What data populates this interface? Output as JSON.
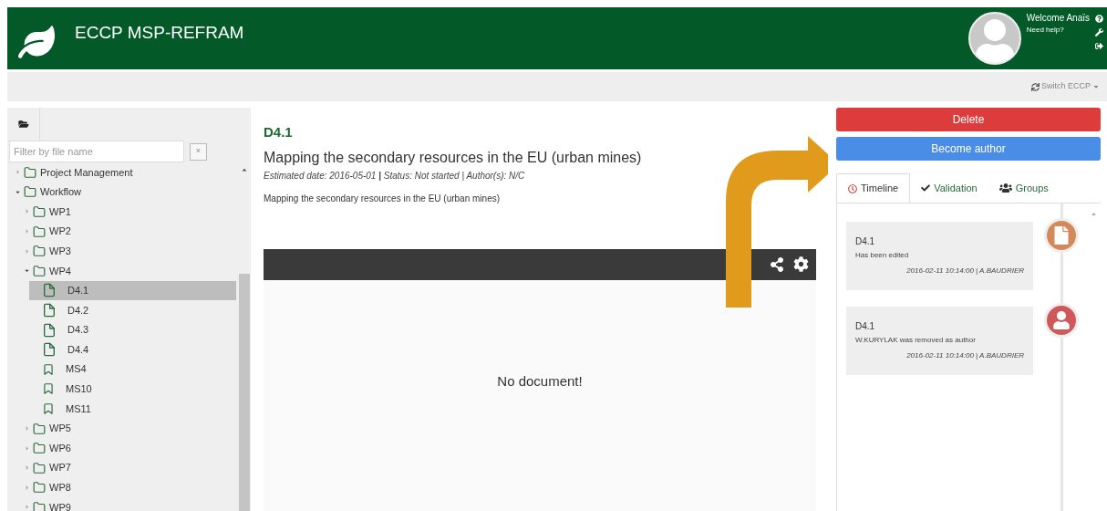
{
  "header": {
    "title": "ECCP MSP-REFRAM",
    "welcome": "Welcome Anaïs",
    "help_link": "Need help?"
  },
  "toolbar": {
    "switch": "Switch ECCP"
  },
  "sidebar": {
    "filter": {
      "placeholder": "Filter by file name",
      "clear": "×"
    },
    "tree": [
      {
        "label": "Project Management",
        "kind": "folder",
        "expanded": false,
        "selected": false
      },
      {
        "label": "Workflow",
        "kind": "folder",
        "expanded": true,
        "selected": false,
        "children": [
          {
            "label": "WP1",
            "kind": "folder",
            "expanded": false,
            "selected": false
          },
          {
            "label": "WP2",
            "kind": "folder",
            "expanded": false,
            "selected": false
          },
          {
            "label": "WP3",
            "kind": "folder",
            "expanded": false,
            "selected": false
          },
          {
            "label": "WP4",
            "kind": "folder",
            "expanded": true,
            "selected": false,
            "children": [
              {
                "label": "D4.1",
                "kind": "document",
                "selected": true
              },
              {
                "label": "D4.2",
                "kind": "document",
                "selected": false
              },
              {
                "label": "D4.3",
                "kind": "document",
                "selected": false
              },
              {
                "label": "D4.4",
                "kind": "document",
                "selected": false
              },
              {
                "label": "MS4",
                "kind": "milestone",
                "selected": false
              },
              {
                "label": "MS10",
                "kind": "milestone",
                "selected": false
              },
              {
                "label": "MS11",
                "kind": "milestone",
                "selected": false
              }
            ]
          },
          {
            "label": "WP5",
            "kind": "folder",
            "expanded": false,
            "selected": false
          },
          {
            "label": "WP6",
            "kind": "folder",
            "expanded": false,
            "selected": false
          },
          {
            "label": "WP7",
            "kind": "folder",
            "expanded": false,
            "selected": false
          },
          {
            "label": "WP8",
            "kind": "folder",
            "expanded": false,
            "selected": false
          },
          {
            "label": "WP9",
            "kind": "folder",
            "expanded": false,
            "selected": false
          }
        ]
      }
    ]
  },
  "document": {
    "code": "D4.1",
    "title": "Mapping the secondary resources in the EU (urban mines)",
    "meta": "*Estimated date: 2016-05-01* **|** *Status: Not started | Author(s): N/C*",
    "description": "Mapping the secondary resources in the EU (urban mines)",
    "viewer_message": "No document!"
  },
  "actions": {
    "buttons": [
      "Delete",
      "Become author"
    ]
  },
  "tabs": [
    {
      "label": "Timeline",
      "selected": true
    },
    {
      "label": "Validation",
      "selected": false
    },
    {
      "label": "Groups",
      "selected": false
    }
  ],
  "timeline": [
    {
      "kind": "document",
      "title": "D4.1",
      "text": "Has been edited",
      "meta": "2016-02-11 10:14:00 | A.BAUDRIER"
    },
    {
      "kind": "user",
      "title": "D4.1",
      "text": "W.KURYLAK was removed as author",
      "meta": "2016-02-11 10:14:00 | A.BAUDRIER"
    }
  ]
}
